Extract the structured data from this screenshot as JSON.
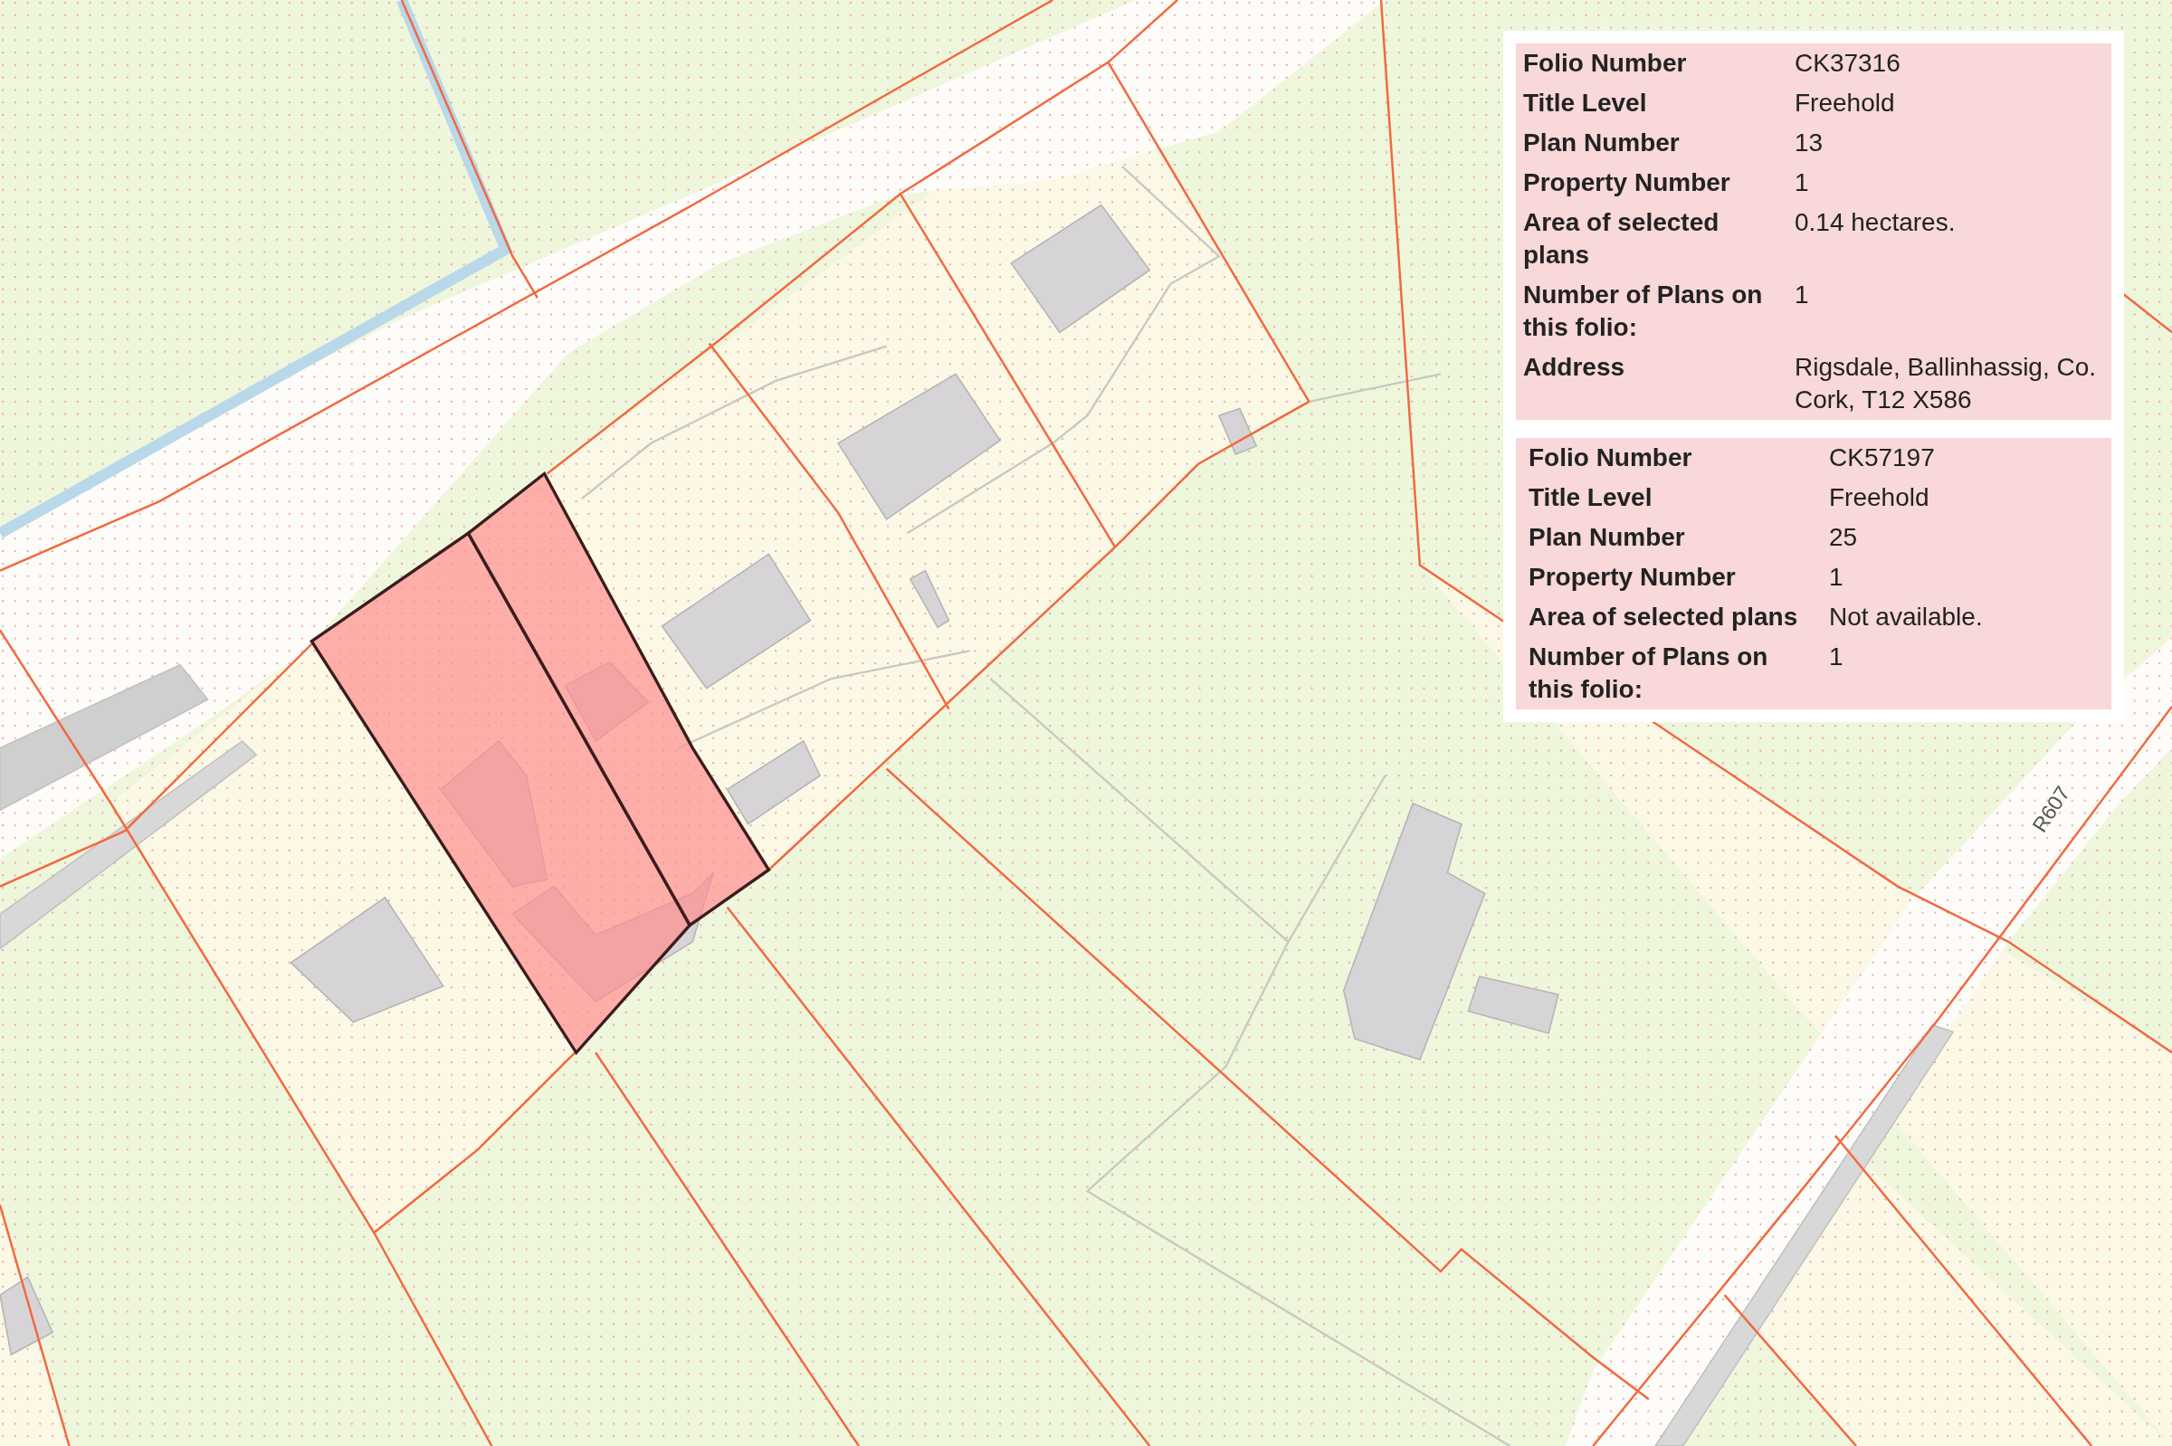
{
  "map": {
    "road_label": "R607"
  },
  "folios": [
    {
      "rows": [
        {
          "label": "Folio Number",
          "value": "CK37316"
        },
        {
          "label": "Title Level",
          "value": "Freehold"
        },
        {
          "label": "Plan Number",
          "value": "13"
        },
        {
          "label": "Property Number",
          "value": "1"
        },
        {
          "label": "Area of selected plans",
          "value": "0.14 hectares."
        },
        {
          "label": "Number of Plans on this folio:",
          "value": "1"
        },
        {
          "label": "Address",
          "value": "Rigsdale, Ballinhassig, Co. Cork, T12 X586"
        }
      ]
    },
    {
      "rows": [
        {
          "label": "Folio Number",
          "value": "CK57197"
        },
        {
          "label": "Title Level",
          "value": "Freehold"
        },
        {
          "label": "Plan Number",
          "value": "25"
        },
        {
          "label": "Property Number",
          "value": "1"
        },
        {
          "label": "Area of selected plans",
          "value": "Not available."
        },
        {
          "label": "Number of Plans on this folio:",
          "value": "1"
        }
      ]
    }
  ]
}
